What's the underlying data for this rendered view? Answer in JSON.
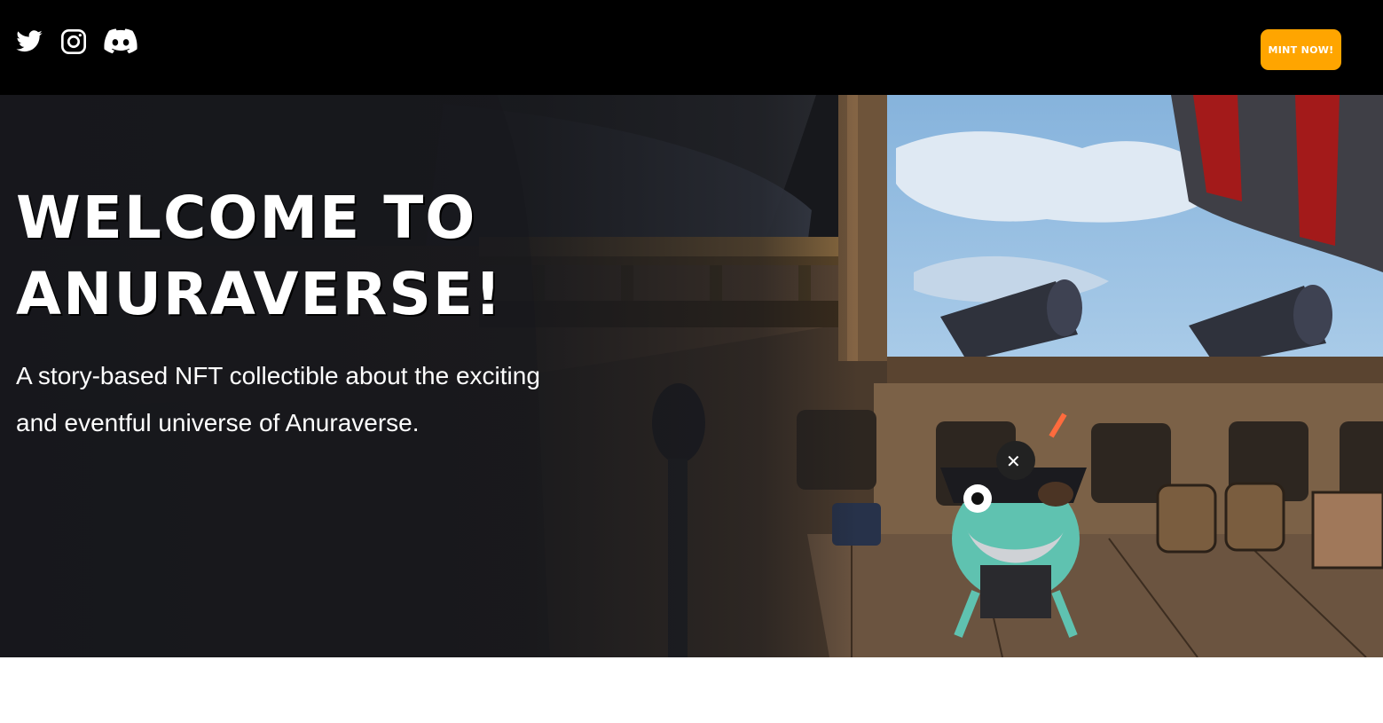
{
  "header": {
    "social_links": [
      {
        "icon": "twitter-icon"
      },
      {
        "icon": "instagram-icon"
      },
      {
        "icon": "discord-icon"
      }
    ],
    "cta_label": "MINT NOW!"
  },
  "hero": {
    "title_line1": "WELCOME TO",
    "title_line2": "ANURAVERSE!",
    "subtitle": "A story-based NFT collectible about the exciting and eventful universe of Anuraverse."
  },
  "colors": {
    "header_bg": "#000000",
    "accent": "#ffa500",
    "hero_overlay": "#17181c",
    "text": "#ffffff"
  }
}
